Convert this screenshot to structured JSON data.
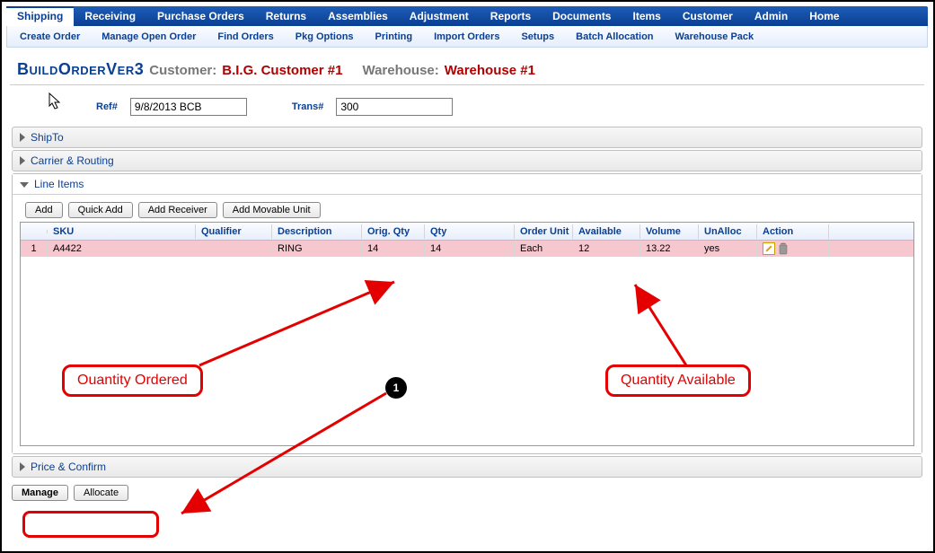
{
  "main_nav": [
    "Shipping",
    "Receiving",
    "Purchase Orders",
    "Returns",
    "Assemblies",
    "Adjustment",
    "Reports",
    "Documents",
    "Items",
    "Customer",
    "Admin",
    "Home"
  ],
  "main_nav_active": 0,
  "sub_nav": [
    "Create Order",
    "Manage Open Order",
    "Find Orders",
    "Pkg Options",
    "Printing",
    "Import Orders",
    "Setups",
    "Batch Allocation",
    "Warehouse Pack"
  ],
  "sub_nav_active": 0,
  "page_title": "BuildOrderVer3",
  "customer_label": "Customer:",
  "customer_value": "B.I.G. Customer #1",
  "warehouse_label": "Warehouse:",
  "warehouse_value": "Warehouse #1",
  "ref_label": "Ref#",
  "ref_value": "9/8/2013 BCB",
  "trans_label": "Trans#",
  "trans_value": "300",
  "sections": {
    "shipto": "ShipTo",
    "carrier": "Carrier & Routing",
    "lineitems": "Line Items",
    "price": "Price & Confirm"
  },
  "line_item_buttons": {
    "add": "Add",
    "quick_add": "Quick Add",
    "add_receiver": "Add Receiver",
    "add_movable": "Add Movable Unit"
  },
  "grid_headers": [
    "",
    "SKU",
    "Qualifier",
    "Description",
    "Orig. Qty",
    "Qty",
    "Order Unit",
    "Available",
    "Volume",
    "UnAlloc",
    "Action"
  ],
  "grid_row": {
    "num": "1",
    "sku": "A4422",
    "qualifier": "",
    "description": "RING",
    "orig_qty": "14",
    "qty": "14",
    "order_unit": "Each",
    "available": "12",
    "volume": "13.22",
    "unalloc": "yes"
  },
  "bottom_buttons": {
    "manage": "Manage",
    "allocate": "Allocate"
  },
  "annotations": {
    "qty_ordered": "Ouantity Ordered",
    "qty_available": "Quantity Available",
    "badge_1": "1"
  }
}
